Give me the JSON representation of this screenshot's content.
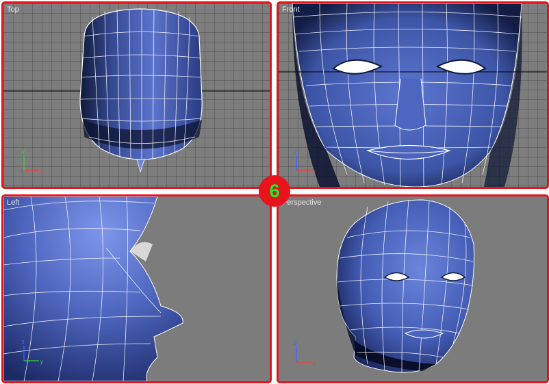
{
  "viewports": {
    "top": {
      "label": "Top"
    },
    "front": {
      "label": "Front"
    },
    "left": {
      "label": "Left"
    },
    "perspective": {
      "label": "Perspective"
    }
  },
  "step_badge": "6",
  "axis_labels": {
    "x": "x",
    "y": "y",
    "z": "z"
  },
  "colors": {
    "frame": "#e8141c",
    "viewport_bg": "#7c7c7c",
    "mesh_fill": "#4a62b8",
    "mesh_wire": "#ffffff",
    "badge_text": "#2ee62e",
    "axis_x": "#ff3a3a",
    "axis_y": "#3ad63a",
    "axis_z": "#3a6aff"
  }
}
